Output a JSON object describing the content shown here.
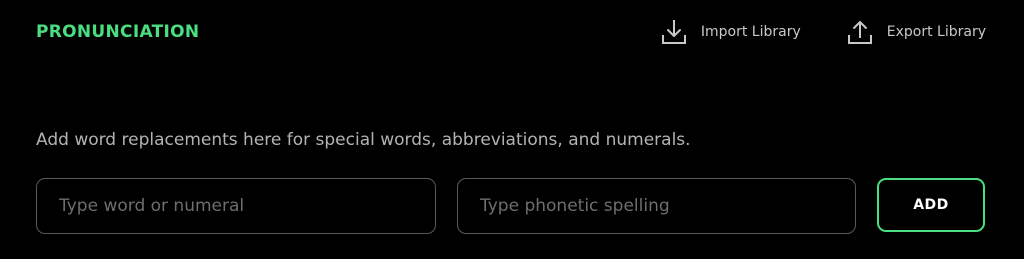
{
  "colors": {
    "background": "#000000",
    "accent": "#4ade80",
    "text_primary": "#ffffff",
    "text_secondary": "#b3b3b3",
    "text_muted": "#c8c8c8",
    "placeholder": "#6e6e6e",
    "field_border": "#5a5a5a"
  },
  "header": {
    "title": "PRONUNCIATION",
    "import": {
      "label": "Import Library",
      "icon": "download-icon"
    },
    "export": {
      "label": "Export Library",
      "icon": "upload-icon"
    }
  },
  "main": {
    "description": "Add word replacements here for special words, abbreviations, and numerals.",
    "word_input": {
      "value": "",
      "placeholder": "Type word or numeral"
    },
    "phonetic_input": {
      "value": "",
      "placeholder": "Type phonetic spelling"
    },
    "add_button": {
      "label": "ADD"
    }
  }
}
